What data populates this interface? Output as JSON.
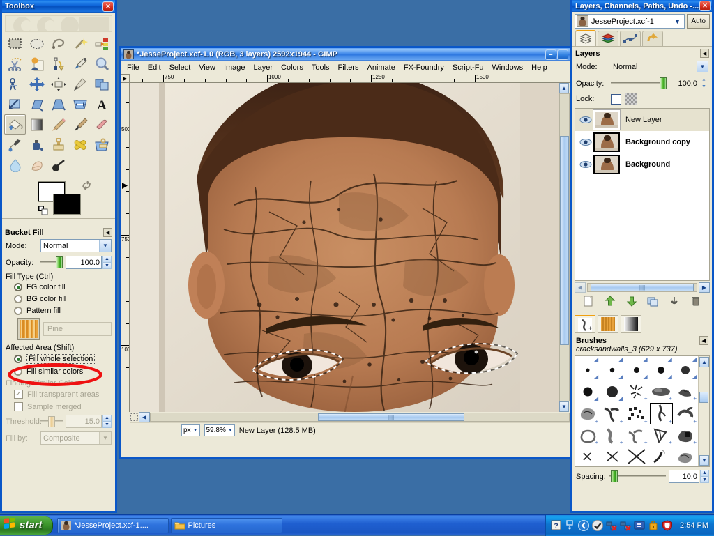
{
  "desktop": {
    "background_color": "#3a6ea5"
  },
  "toolbox": {
    "title": "Toolbox",
    "close_label": "✕",
    "tools": [
      {
        "name": "rect-select-tool",
        "label": "Rectangle Select"
      },
      {
        "name": "ellipse-select-tool",
        "label": "Ellipse Select"
      },
      {
        "name": "free-select-tool",
        "label": "Free Select"
      },
      {
        "name": "fuzzy-select-tool",
        "label": "Fuzzy Select"
      },
      {
        "name": "by-color-select-tool",
        "label": "Select by Color"
      },
      {
        "name": "scissors-select-tool",
        "label": "Scissors Select"
      },
      {
        "name": "foreground-select-tool",
        "label": "Foreground Select"
      },
      {
        "name": "paths-tool",
        "label": "Paths"
      },
      {
        "name": "color-picker-tool",
        "label": "Color Picker"
      },
      {
        "name": "zoom-tool",
        "label": "Zoom"
      },
      {
        "name": "measure-tool",
        "label": "Measure"
      },
      {
        "name": "move-tool",
        "label": "Move"
      },
      {
        "name": "align-tool",
        "label": "Alignment"
      },
      {
        "name": "crop-tool",
        "label": "Crop"
      },
      {
        "name": "rotate-tool",
        "label": "Rotate"
      },
      {
        "name": "scale-tool",
        "label": "Scale"
      },
      {
        "name": "shear-tool",
        "label": "Shear"
      },
      {
        "name": "perspective-tool",
        "label": "Perspective"
      },
      {
        "name": "flip-tool",
        "label": "Flip"
      },
      {
        "name": "text-tool",
        "label": "Text"
      },
      {
        "name": "bucket-fill-tool",
        "label": "Bucket Fill",
        "active": true
      },
      {
        "name": "blend-tool",
        "label": "Blend"
      },
      {
        "name": "pencil-tool",
        "label": "Pencil"
      },
      {
        "name": "paintbrush-tool",
        "label": "Paintbrush"
      },
      {
        "name": "eraser-tool",
        "label": "Eraser"
      },
      {
        "name": "airbrush-tool",
        "label": "Airbrush"
      },
      {
        "name": "ink-tool",
        "label": "Ink"
      },
      {
        "name": "clone-tool",
        "label": "Clone"
      },
      {
        "name": "heal-tool",
        "label": "Heal"
      },
      {
        "name": "perspective-clone-tool",
        "label": "Perspective Clone"
      },
      {
        "name": "blur-sharpen-tool",
        "label": "Blur / Sharpen"
      },
      {
        "name": "smudge-tool",
        "label": "Smudge"
      },
      {
        "name": "dodge-burn-tool",
        "label": "Dodge / Burn"
      }
    ],
    "colors": {
      "foreground": "#ffffff",
      "background": "#000000"
    },
    "options": {
      "title": "Bucket Fill",
      "mode_label": "Mode:",
      "mode_value": "Normal",
      "opacity_label": "Opacity:",
      "opacity_value": "100.0",
      "fill_type_label": "Fill Type  (Ctrl)",
      "fill_types": [
        {
          "label": "FG color fill",
          "selected": true
        },
        {
          "label": "BG color fill",
          "selected": false
        },
        {
          "label": "Pattern fill",
          "selected": false
        }
      ],
      "pattern_name": "Pine",
      "affected_area_label": "Affected Area  (Shift)",
      "affected_areas": [
        {
          "label": "Fill whole selection",
          "selected": true,
          "highlighted": true
        },
        {
          "label": "Fill similar colors",
          "selected": false
        }
      ],
      "finding_label": "Finding Similar Colors",
      "fill_transparent_label": "Fill transparent areas",
      "fill_transparent_checked": true,
      "sample_merged_label": "Sample merged",
      "sample_merged_checked": false,
      "threshold_label": "Threshold:",
      "threshold_value": "15.0",
      "fill_by_label": "Fill by:",
      "fill_by_value": "Composite",
      "highlight_color": "#ee1111"
    }
  },
  "image_window": {
    "title": "*JesseProject.xcf-1.0 (RGB, 3 layers) 2592x1944 - GIMP",
    "minimize_label": "–",
    "maximize_label": "❐",
    "close_label": "✕",
    "menus": [
      "File",
      "Edit",
      "Select",
      "View",
      "Image",
      "Layer",
      "Colors",
      "Tools",
      "Filters",
      "Animate",
      "FX-Foundry",
      "Script-Fu",
      "Windows",
      "Help"
    ],
    "ruler_h_labels": [
      "750",
      "1000",
      "1250",
      "1500"
    ],
    "ruler_v_labels": [
      "500",
      "750",
      "1000"
    ],
    "statusbar": {
      "unit": "px",
      "zoom": "59.8%",
      "message": "New Layer (128.5 MB)"
    }
  },
  "layers_dock": {
    "title": "Layers, Channels, Paths, Undo -...",
    "close_label": "✕",
    "image_selector": "JesseProject.xcf-1",
    "auto_label": "Auto",
    "tabs": [
      {
        "name": "tab-layers",
        "label": "Layers",
        "active": true
      },
      {
        "name": "tab-channels",
        "label": "Channels",
        "active": false
      },
      {
        "name": "tab-paths",
        "label": "Paths",
        "active": false
      },
      {
        "name": "tab-undo",
        "label": "Undo History",
        "active": false
      }
    ],
    "panel_title": "Layers",
    "mode_label": "Mode:",
    "mode_value": "Normal",
    "opacity_label": "Opacity:",
    "opacity_value": "100.0",
    "lock_label": "Lock:",
    "layers": [
      {
        "name": "New Layer",
        "visible": true,
        "selected": true
      },
      {
        "name": "Background copy",
        "visible": true,
        "selected": false
      },
      {
        "name": "Background",
        "visible": true,
        "selected": false
      }
    ],
    "layer_buttons": [
      {
        "name": "new-layer-button",
        "label": "New Layer"
      },
      {
        "name": "raise-layer-button",
        "label": "Raise Layer"
      },
      {
        "name": "lower-layer-button",
        "label": "Lower Layer"
      },
      {
        "name": "duplicate-layer-button",
        "label": "Duplicate Layer"
      },
      {
        "name": "anchor-layer-button",
        "label": "Anchor Layer"
      },
      {
        "name": "delete-layer-button",
        "label": "Delete Layer"
      }
    ],
    "brush_tabs": [
      {
        "name": "tab-brushes",
        "label": "Brushes",
        "active": true
      },
      {
        "name": "tab-patterns",
        "label": "Patterns",
        "active": false
      },
      {
        "name": "tab-gradients",
        "label": "Gradients",
        "active": false
      }
    ],
    "brushes_title": "Brushes",
    "brush_selected": "cracksandwalls_3 (629 x 737)",
    "spacing_label": "Spacing:",
    "spacing_value": "10.0"
  },
  "taskbar": {
    "start_label": "start",
    "items": [
      {
        "name": "taskbar-item-gimp",
        "label": "*JesseProject.xcf-1...."
      },
      {
        "name": "taskbar-item-pictures",
        "label": "Pictures"
      }
    ],
    "clock": "2:54 PM"
  }
}
